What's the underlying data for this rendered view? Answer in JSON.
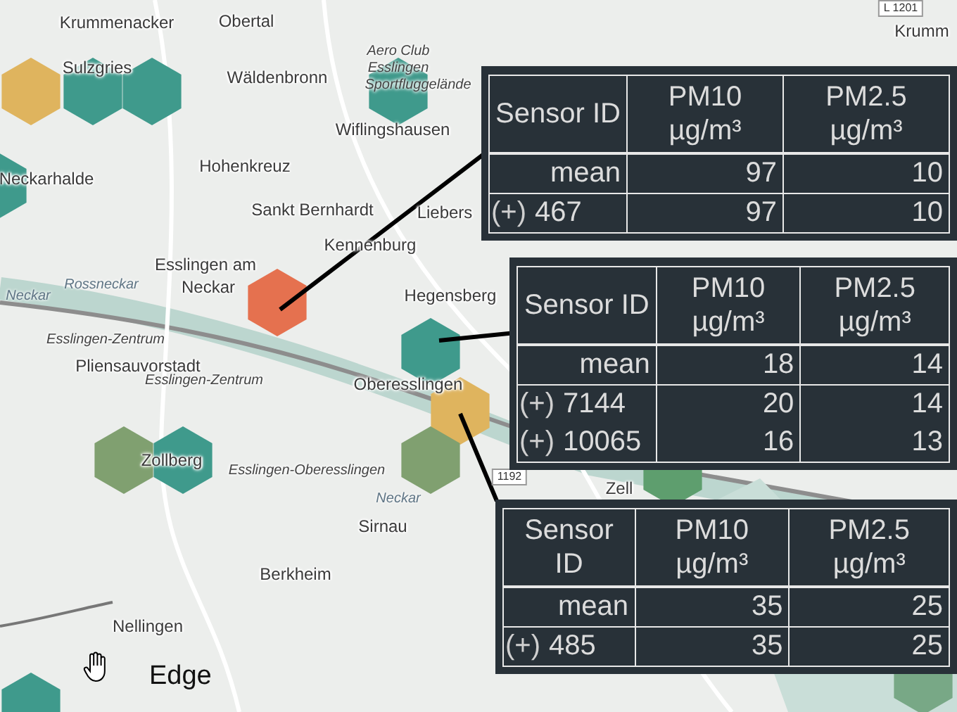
{
  "map": {
    "labels": [
      {
        "text": "Krummenacker",
        "kind": "place"
      },
      {
        "text": "Obertal",
        "kind": "place"
      },
      {
        "text": "Sulzgries",
        "kind": "place"
      },
      {
        "text": "Wäldenbronn",
        "kind": "place"
      },
      {
        "text": "Aero Club",
        "kind": "poi"
      },
      {
        "text": "Esslingen",
        "kind": "poi"
      },
      {
        "text": "Sportfluggelände",
        "kind": "poi"
      },
      {
        "text": "Wiflingshausen",
        "kind": "place"
      },
      {
        "text": "Hohenkreuz",
        "kind": "place"
      },
      {
        "text": "Neckarhalde",
        "kind": "place"
      },
      {
        "text": "Sankt Bernhardt",
        "kind": "place"
      },
      {
        "text": "Liebers",
        "kind": "place"
      },
      {
        "text": "Kennenburg",
        "kind": "place"
      },
      {
        "text": "Esslingen am",
        "kind": "place"
      },
      {
        "text": "Neckar",
        "kind": "place"
      },
      {
        "text": "Hegensberg",
        "kind": "place"
      },
      {
        "text": "Neckar",
        "kind": "water"
      },
      {
        "text": "Rossneckar",
        "kind": "water"
      },
      {
        "text": "Esslingen-Zentrum",
        "kind": "poi"
      },
      {
        "text": "Pliensauvorstadt",
        "kind": "place"
      },
      {
        "text": "Esslingen-Zentrum",
        "kind": "poi"
      },
      {
        "text": "Oberesslingen",
        "kind": "place"
      },
      {
        "text": "Zollberg",
        "kind": "place"
      },
      {
        "text": "Esslingen-Oberesslingen",
        "kind": "poi"
      },
      {
        "text": "Neckar",
        "kind": "water"
      },
      {
        "text": "1192",
        "kind": "road"
      },
      {
        "text": "Zell",
        "kind": "place"
      },
      {
        "text": "Sirnau",
        "kind": "place"
      },
      {
        "text": "Berkheim",
        "kind": "place"
      },
      {
        "text": "Nellingen",
        "kind": "place"
      },
      {
        "text": "L 1201",
        "kind": "road"
      },
      {
        "text": "Krumm",
        "kind": "place"
      }
    ],
    "hexagons": [
      {
        "color": "#dfb45e"
      },
      {
        "color": "#3f9a8c"
      },
      {
        "color": "#3f9a8c"
      },
      {
        "color": "#3f9a8c"
      },
      {
        "color": "#3f9a8c"
      },
      {
        "color": "#e5714f"
      },
      {
        "color": "#3f9a8c"
      },
      {
        "color": "#dfb45e"
      },
      {
        "color": "#80a070"
      },
      {
        "color": "#80a070"
      },
      {
        "color": "#3f9a8c"
      },
      {
        "color": "#5e9e6e"
      },
      {
        "color": "#78a886"
      },
      {
        "color": "#3f9a8c"
      }
    ]
  },
  "popups": [
    {
      "columns": [
        {
          "name": "Sensor ID"
        },
        {
          "name": "PM10",
          "unit": "µg/m³"
        },
        {
          "name": "PM2.5",
          "unit": "µg/m³"
        }
      ],
      "summary": {
        "label": "mean",
        "values": [
          "97",
          "10"
        ]
      },
      "sensors": [
        {
          "toggle": "(+)",
          "id": "467",
          "values": [
            "97",
            "10"
          ]
        }
      ]
    },
    {
      "columns": [
        {
          "name": "Sensor ID"
        },
        {
          "name": "PM10",
          "unit": "µg/m³"
        },
        {
          "name": "PM2.5",
          "unit": "µg/m³"
        }
      ],
      "summary": {
        "label": "mean",
        "values": [
          "18",
          "14"
        ]
      },
      "sensors": [
        {
          "toggle": "(+)",
          "id": "7144",
          "values": [
            "20",
            "14"
          ]
        },
        {
          "toggle": "(+)",
          "id": "10065",
          "values": [
            "16",
            "13"
          ]
        }
      ]
    },
    {
      "columns": [
        {
          "name": "Sensor ID"
        },
        {
          "name": "PM10",
          "unit": "µg/m³"
        },
        {
          "name": "PM2.5",
          "unit": "µg/m³"
        }
      ],
      "summary": {
        "label": "mean",
        "values": [
          "35",
          "25"
        ]
      },
      "sensors": [
        {
          "toggle": "(+)",
          "id": "485",
          "values": [
            "35",
            "25"
          ]
        }
      ]
    }
  ],
  "cursor_label": "Edge"
}
